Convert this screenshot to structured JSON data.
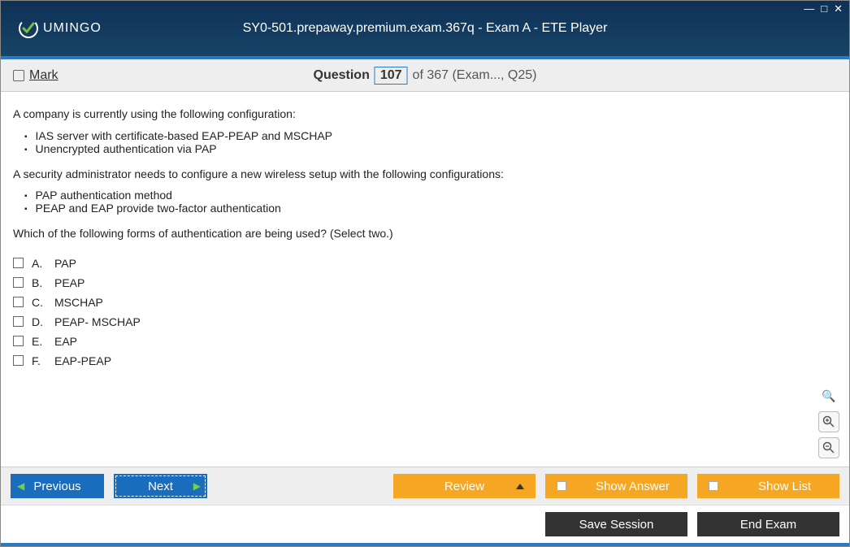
{
  "header": {
    "logo_text": "UMINGO",
    "title": "SY0-501.prepaway.premium.exam.367q - Exam A - ETE Player"
  },
  "qbar": {
    "mark": "Mark",
    "word": "Question",
    "num": "107",
    "rest": "of 367 (Exam..., Q25)"
  },
  "body": {
    "p1": "A company is currently using the following configuration:",
    "b1a": "IAS server with certificate-based EAP-PEAP and MSCHAP",
    "b1b": "Unencrypted authentication via PAP",
    "p2": "A security administrator needs to configure a new wireless setup with the following configurations:",
    "b2a": "PAP authentication method",
    "b2b": "PEAP and EAP provide two-factor authentication",
    "p3": "Which of the following forms of authentication are being used? (Select two.)"
  },
  "answers": [
    {
      "l": "A.",
      "t": "PAP"
    },
    {
      "l": "B.",
      "t": "PEAP"
    },
    {
      "l": "C.",
      "t": "MSCHAP"
    },
    {
      "l": "D.",
      "t": "PEAP- MSCHAP"
    },
    {
      "l": "E.",
      "t": "EAP"
    },
    {
      "l": "F.",
      "t": "EAP-PEAP"
    }
  ],
  "buttons": {
    "prev": "Previous",
    "next": "Next",
    "review": "Review",
    "show_answer": "Show Answer",
    "show_list": "Show List",
    "save": "Save Session",
    "end": "End Exam"
  }
}
